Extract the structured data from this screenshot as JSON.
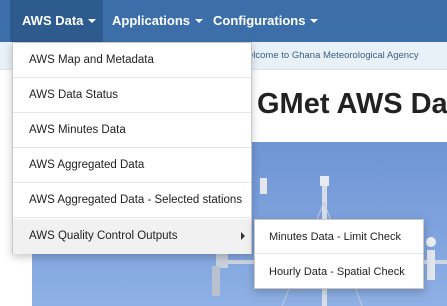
{
  "navbar": {
    "items": [
      {
        "label": "AWS Data"
      },
      {
        "label": "Applications"
      },
      {
        "label": "Configurations"
      }
    ]
  },
  "welcome": {
    "text": "elcome to Ghana Meteorological Agency"
  },
  "heading": {
    "text": "GMet AWS Da"
  },
  "dropdown": {
    "items": [
      {
        "label": "AWS Map and Metadata"
      },
      {
        "label": "AWS Data Status"
      },
      {
        "label": "AWS Minutes Data"
      },
      {
        "label": "AWS Aggregated Data"
      },
      {
        "label": "AWS Aggregated Data - Selected stations"
      },
      {
        "label": "AWS Quality Control Outputs"
      }
    ]
  },
  "submenu": {
    "items": [
      {
        "label": "Minutes Data - Limit Check"
      },
      {
        "label": "Hourly Data - Spatial Check"
      }
    ]
  },
  "colors": {
    "navbar": "#3c6fa9",
    "navbar_active": "#2e5b8e",
    "welcome_bar": "#e9f1f8",
    "sky": "#7fa3de"
  }
}
